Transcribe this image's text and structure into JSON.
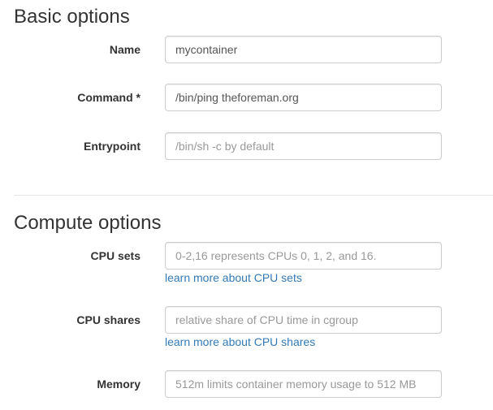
{
  "basic_options": {
    "title": "Basic options",
    "fields": {
      "name": {
        "label": "Name",
        "value": "mycontainer",
        "placeholder": ""
      },
      "command": {
        "label": "Command *",
        "value": "/bin/ping theforeman.org",
        "placeholder": ""
      },
      "entrypoint": {
        "label": "Entrypoint",
        "value": "",
        "placeholder": "/bin/sh -c by default"
      }
    }
  },
  "compute_options": {
    "title": "Compute options",
    "fields": {
      "cpu_sets": {
        "label": "CPU sets",
        "value": "",
        "placeholder": "0-2,16 represents CPUs 0, 1, 2, and 16.",
        "help_link": "learn more about CPU sets"
      },
      "cpu_shares": {
        "label": "CPU shares",
        "value": "",
        "placeholder": "relative share of CPU time in cgroup",
        "help_link": "learn more about CPU shares"
      },
      "memory": {
        "label": "Memory",
        "value": "",
        "placeholder": "512m limits container memory usage to 512 MB"
      }
    }
  },
  "colors": {
    "link": "#337ab7",
    "input_border": "#cccccc",
    "placeholder": "#999999",
    "text": "#333333"
  }
}
